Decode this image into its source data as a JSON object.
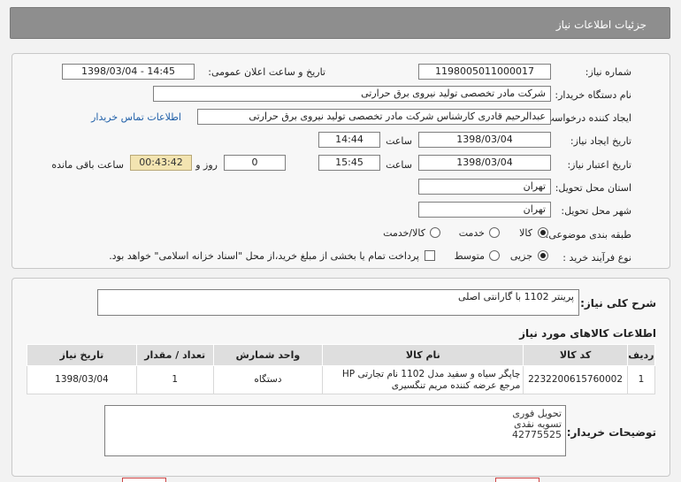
{
  "header": {
    "title": "جزئیات اطلاعات نیاز"
  },
  "form": {
    "need_number_label": "شماره نیاز:",
    "need_number": "1198005011000017",
    "announce_label": "تاریخ و ساعت اعلان عمومی:",
    "announce_value": "1398/03/04 - 14:45",
    "buyer_label": "نام دستگاه خریدار:",
    "buyer_value": "شرکت مادر تخصصی تولید نیروی برق حرارتی",
    "requester_label": "ایجاد کننده درخواست:",
    "requester_value": "عبدالرحیم قادری کارشناس شرکت مادر تخصصی تولید نیروی برق حرارتی",
    "contact_link": "اطلاعات تماس خریدار",
    "created_label": "تاریخ ایجاد نیاز:",
    "created_date": "1398/03/04",
    "time_label": "ساعت",
    "created_time": "14:44",
    "validity_label": "تاریخ اعتبار نیاز:",
    "validity_date": "1398/03/04",
    "validity_time": "15:45",
    "days_label": "روز و",
    "days_value": "0",
    "remaining_time": "00:43:42",
    "remaining_label": "ساعت باقی مانده",
    "province_label": "استان محل تحویل:",
    "province_value": "تهران",
    "city_label": "شهر محل تحویل:",
    "city_value": "تهران",
    "category_label": "طبقه بندی موضوعی:",
    "category_options": [
      "کالا",
      "خدمت",
      "کالا/خدمت"
    ],
    "category_selected": "کالا",
    "process_label": "نوع فرآیند خرید :",
    "process_options": [
      "جزیی",
      "متوسط"
    ],
    "process_selected": "جزیی",
    "payment_note": "پرداخت تمام یا بخشی از مبلغ خرید،از محل \"اسناد خزانه اسلامی\" خواهد بود."
  },
  "details": {
    "summary_label": "شرح کلی نیاز:",
    "summary_value": "پرینتر 1102 با گارانتی اصلی",
    "items_title": "اطلاعات کالاهای مورد نیاز",
    "columns": [
      "ردیف",
      "کد کالا",
      "نام کالا",
      "واحد شمارش",
      "تعداد / مقدار",
      "تاریخ نیاز"
    ],
    "rows": [
      {
        "row": "1",
        "code": "2232200615760002",
        "name": "چاپگر سیاه و سفید مدل 1102 نام تجارتی HP مرجع عرضه کننده مریم تنگسیری",
        "unit": "دستگاه",
        "qty": "1",
        "date": "1398/03/04"
      }
    ],
    "notes_label": "توضیحات خریدار:",
    "notes_lines": [
      "تحویل فوری",
      "تسویه نقدی",
      "42775525"
    ]
  }
}
